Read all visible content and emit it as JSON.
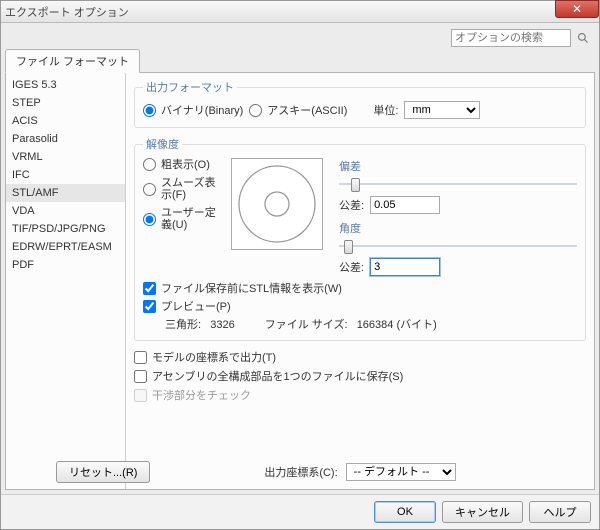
{
  "window": {
    "title": "エクスポート オプション"
  },
  "search": {
    "placeholder": "オプションの検索"
  },
  "tab": {
    "label": "ファイル フォーマット"
  },
  "sidebar": {
    "items": [
      "IGES 5.3",
      "STEP",
      "ACIS",
      "Parasolid",
      "VRML",
      "IFC",
      "STL/AMF",
      "VDA",
      "TIF/PSD/JPG/PNG",
      "EDRW/EPRT/EASM",
      "PDF"
    ],
    "selected_index": 6
  },
  "output_format": {
    "legend": "出力フォーマット",
    "binary_label": "バイナリ(Binary)",
    "ascii_label": "アスキー(ASCII)",
    "selected": "binary",
    "unit_label": "単位:",
    "unit_value": "mm"
  },
  "resolution": {
    "legend": "解像度",
    "coarse_label": "粗表示(O)",
    "fine_label": "スムーズ表示(F)",
    "custom_label": "ユーザー定義(U)",
    "selected": "custom",
    "deviation": {
      "label": "偏差",
      "tol_label": "公差:",
      "tol_value": "0.05",
      "slider_pos": 0.05
    },
    "angle": {
      "label": "角度",
      "tol_label": "公差:",
      "tol_value": "3",
      "slider_pos": 0.02
    }
  },
  "show_info": {
    "label": "ファイル保存前にSTL情報を表示(W)",
    "checked": true
  },
  "preview": {
    "label": "プレビュー(P)",
    "checked": true
  },
  "stats": {
    "tri_label": "三角形:",
    "tri_value": "3326",
    "size_label": "ファイル サイズ:",
    "size_value": "166384 (バイト)"
  },
  "opts": {
    "model_cs": {
      "label": "モデルの座標系で出力(T)",
      "checked": false
    },
    "save_all": {
      "label": "アセンブリの全構成部品を1つのファイルに保存(S)",
      "checked": false
    },
    "check_interf": {
      "label": "干渉部分をチェック",
      "checked": false,
      "disabled": true
    }
  },
  "coord": {
    "label": "出力座標系(C):",
    "value": "-- デフォルト --"
  },
  "buttons": {
    "reset": "リセット...(R)",
    "ok": "OK",
    "cancel": "キャンセル",
    "help": "ヘルプ"
  }
}
